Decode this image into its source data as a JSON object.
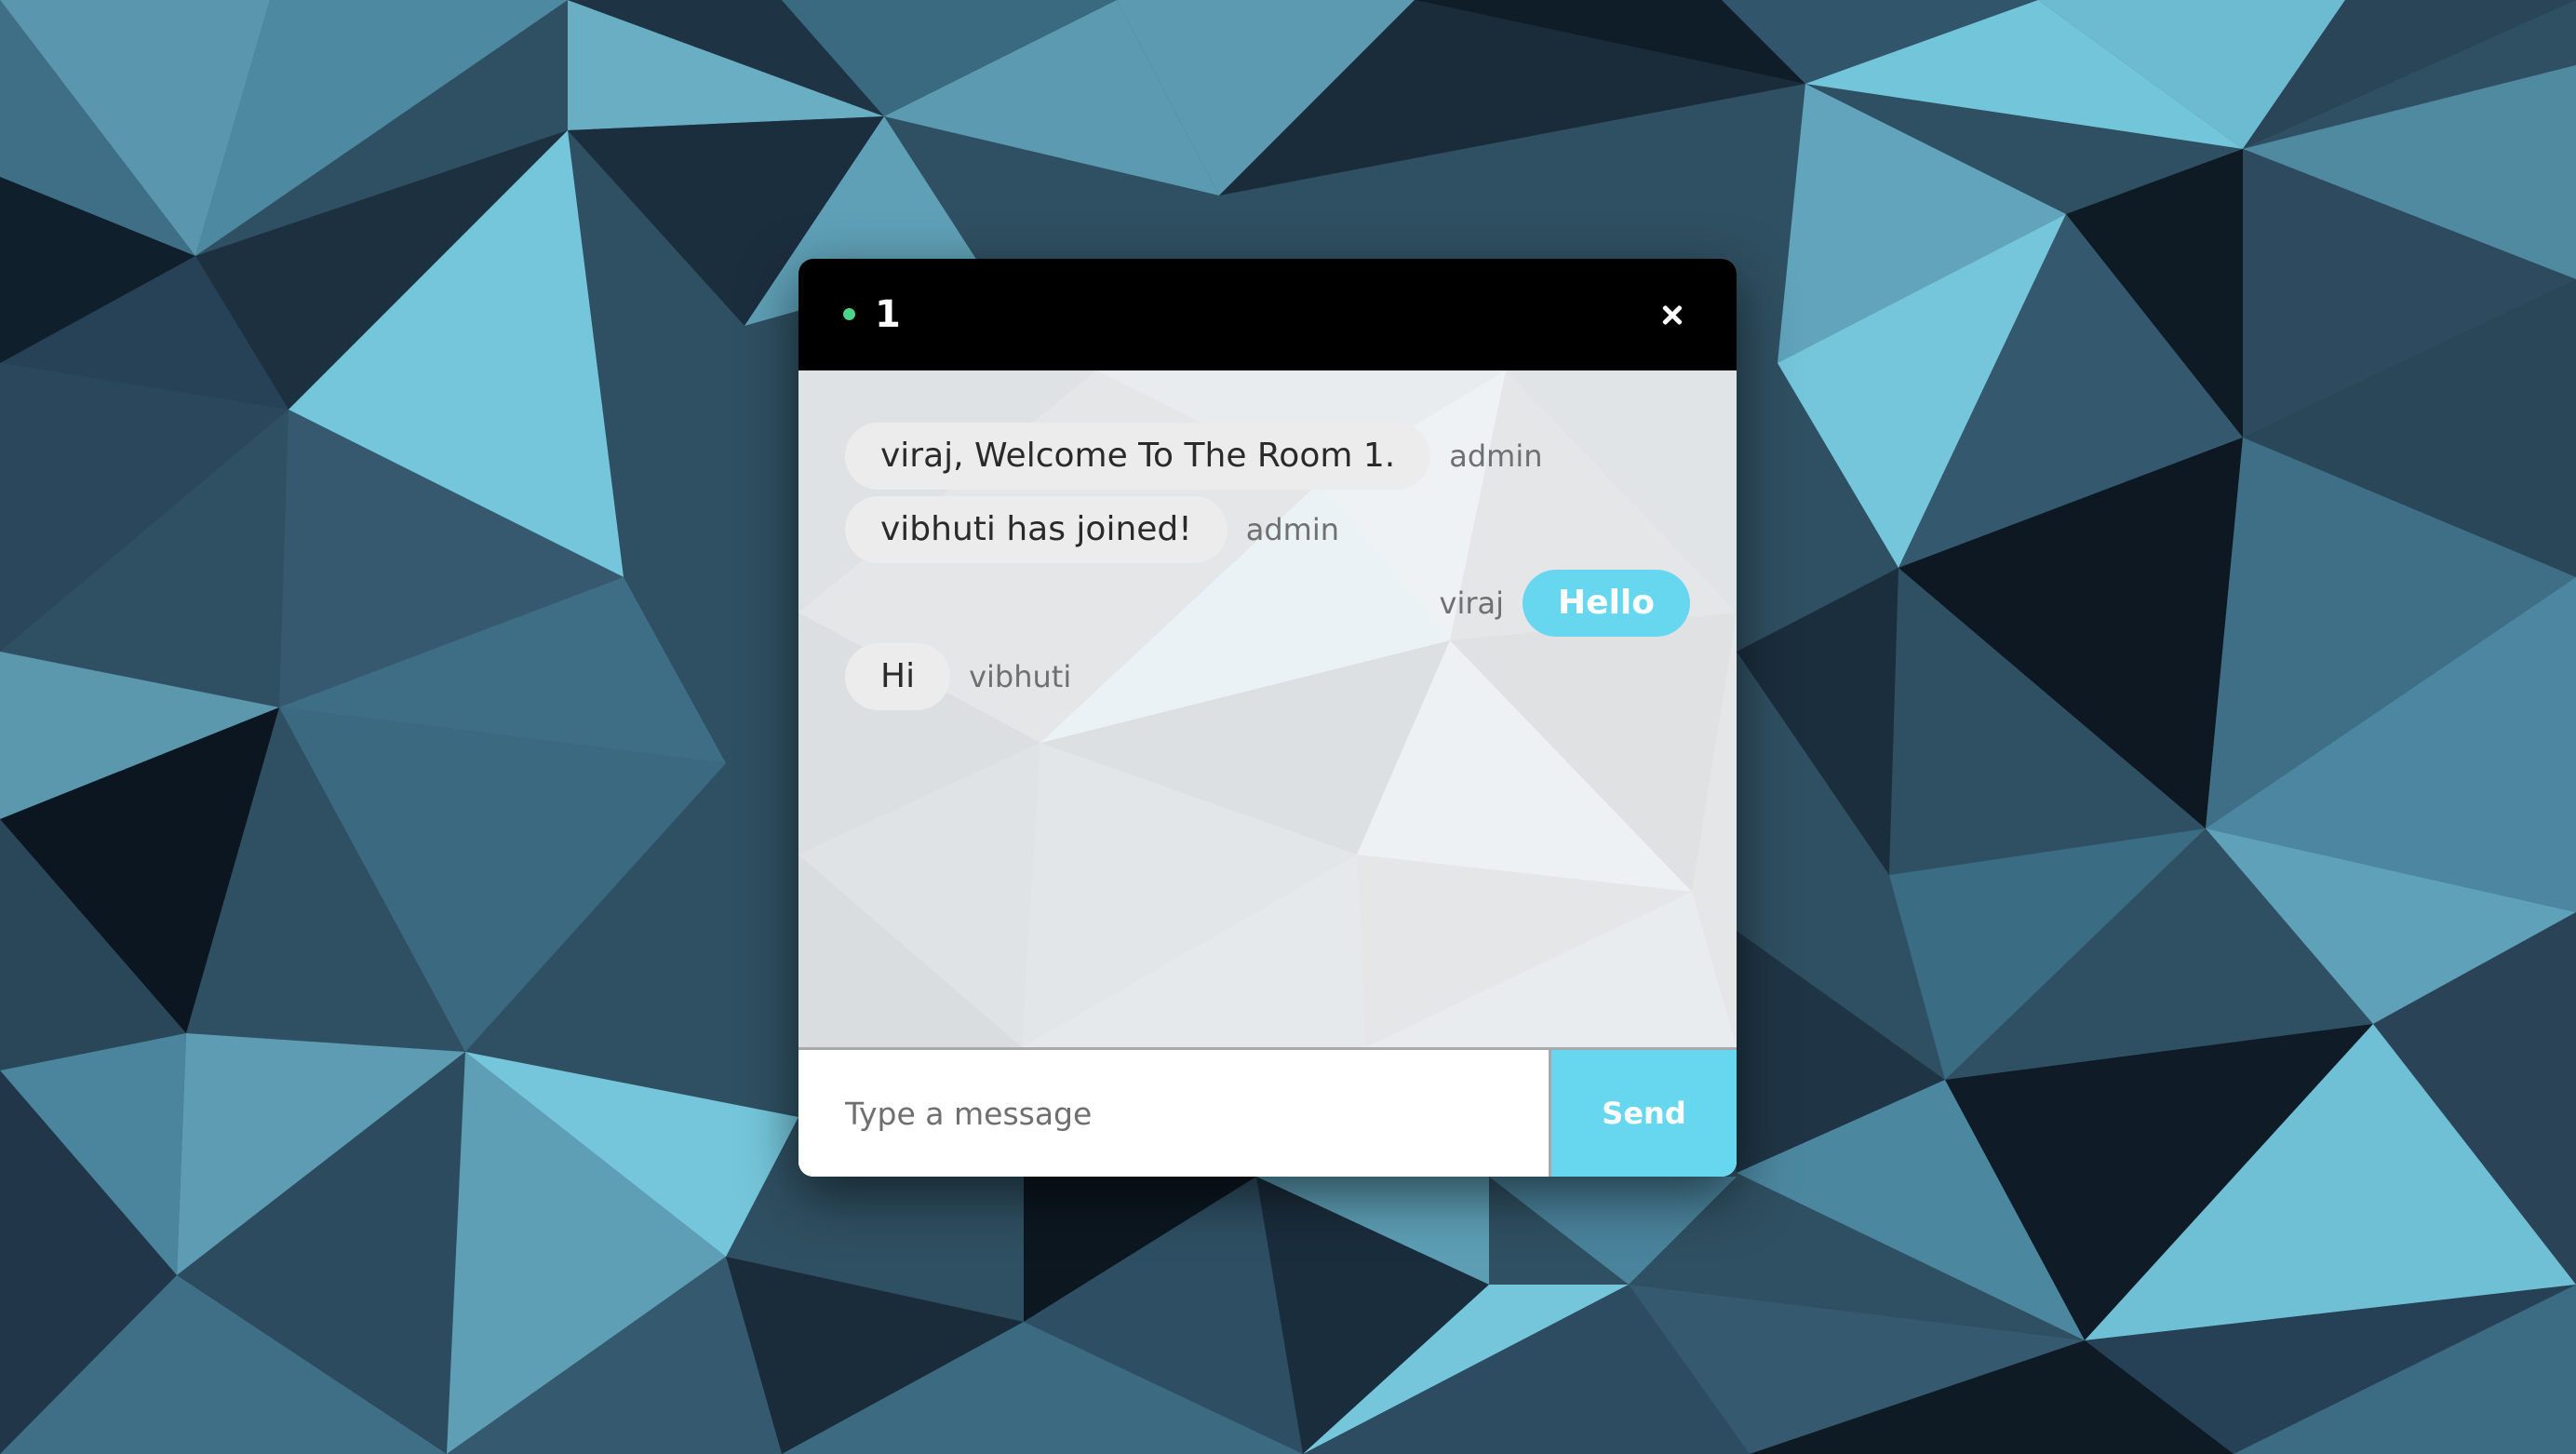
{
  "colors": {
    "header_bg": "#000000",
    "online_dot": "#4cd48a",
    "own_bubble": "#67d7f0",
    "other_bubble": "#ececec",
    "send_button": "#67d7f0"
  },
  "header": {
    "room_name": "1",
    "online_indicator_icon": "online-dot",
    "close_icon": "close-x"
  },
  "messages": [
    {
      "text": "viraj, Welcome To The Room 1.",
      "sender": "admin",
      "own": false
    },
    {
      "text": "vibhuti has joined!",
      "sender": "admin",
      "own": false
    },
    {
      "text": "Hello",
      "sender": "viraj",
      "own": true
    },
    {
      "text": "Hi",
      "sender": "vibhuti",
      "own": false
    }
  ],
  "composer": {
    "placeholder": "Type a message",
    "value": "",
    "send_label": "Send"
  }
}
